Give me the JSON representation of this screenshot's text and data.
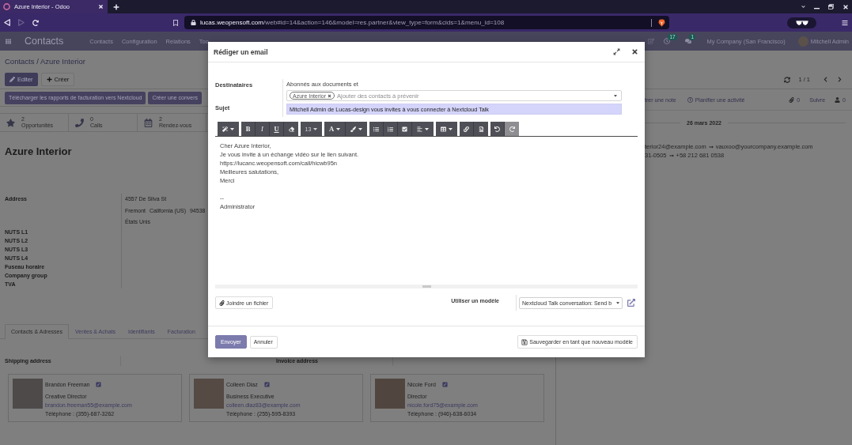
{
  "browser": {
    "tab_title": "Azure Interior - Odoo",
    "nav": [
      {
        "kind": "back",
        "disabled": false
      },
      {
        "kind": "forward",
        "disabled": true
      },
      {
        "kind": "reload",
        "disabled": false
      }
    ],
    "url_host": "lucas.weopensoft.com",
    "url_path": "/web#id=14&action=146&model=res.partner&view_type=form&cids=1&menu_id=108"
  },
  "navbar": {
    "app": "Contacts",
    "menu": [
      "Contacts",
      "Configuration",
      "Relations",
      "Too"
    ],
    "activity_count": "17",
    "message_count": "1",
    "company": "My Company (San Francisco)",
    "user": "Mitchell Admin"
  },
  "control_panel": {
    "breadcrumb": "Contacts / Azure Interior",
    "edit": "Editer",
    "create": "Créer",
    "pager": "1 / 1"
  },
  "form": {
    "action_buttons": [
      "Télécharger les rapports de facturation vers Nextcloud",
      "Créer une convers"
    ],
    "stat_buttons": [
      {
        "kind": "star",
        "value": "2",
        "label": "Opportunités"
      },
      {
        "kind": "phone",
        "value": "0",
        "label": "Calls"
      },
      {
        "kind": "calendar",
        "value": "2",
        "label": "Rendez-vous"
      }
    ],
    "name": "Azure Interior",
    "address_label": "Address",
    "address": {
      "street": "4557 De Silva St",
      "city_line": [
        "Fremont",
        "California (US)",
        "94538"
      ],
      "country": "États Unis"
    },
    "field_labels": [
      "NUTS L1",
      "NUTS L2",
      "NUTS L3",
      "NUTS L4",
      "Fuseau horaire",
      "Company group",
      "TVA"
    ],
    "tabs": [
      {
        "label": "Contacts & Adresses",
        "selected": true
      },
      {
        "label": "Ventes & Achats",
        "selected": false
      },
      {
        "label": "Identifiants",
        "selected": false
      },
      {
        "label": "Facturation",
        "selected": false
      }
    ],
    "address_headers": [
      "Shipping address",
      "Invoice address"
    ],
    "contacts": [
      {
        "name": "Brandon Freeman",
        "function": "Creative Director",
        "email": "brandon.freeman55@example.com",
        "phone": "Téléphone : (355)-687-3262"
      },
      {
        "name": "Colleen Diaz",
        "function": "Business Executive",
        "email": "colleen.diaz83@example.com",
        "phone": "Téléphone : (255)-595-8393"
      },
      {
        "name": "Nicole Ford",
        "function": "Director",
        "email": "nicole.ford75@example.com",
        "phone": "Téléphone : (946)-638-6034"
      }
    ]
  },
  "chatter": {
    "log_note": "trer une note",
    "schedule": "Planifier une activité",
    "attachment_count": "0",
    "follow": "Suivre",
    "follower_count": "0",
    "date": "26 mars 2022",
    "tracking": [
      {
        "old": "terior24@example.com",
        "new": "vauxoo@yourcompany.example.com"
      },
      {
        "old": "31-0505",
        "new": "+58 212 681 0538"
      }
    ]
  },
  "dialog": {
    "title": "Rédiger un email",
    "recipients": {
      "label": "Destinataires",
      "note": "Abonnés aux documents et",
      "tags": [
        {
          "label": "Azure Interior"
        }
      ],
      "placeholder": "Ajouter des contacts à prévenir",
      "required": false
    },
    "subject": {
      "label": "Sujet",
      "value": "Mitchell Admin de Lucas-design vous invites à vous connecter à Nextcloud Talk",
      "required": true
    },
    "toolbar": [
      {
        "buttons": [
          {
            "kind": "style",
            "disabled": false
          }
        ]
      },
      {
        "buttons": [
          {
            "kind": "bold",
            "label": "B",
            "disabled": false
          },
          {
            "kind": "italic",
            "label": "I",
            "disabled": false
          },
          {
            "kind": "underline",
            "label": "U",
            "disabled": false
          },
          {
            "kind": "eraser",
            "disabled": false
          }
        ]
      },
      {
        "buttons": [
          {
            "kind": "size",
            "label": "13",
            "disabled": false
          }
        ]
      },
      {
        "buttons": [
          {
            "kind": "color",
            "label": "A",
            "disabled": false
          },
          {
            "kind": "brush",
            "disabled": false
          }
        ]
      },
      {
        "buttons": [
          {
            "kind": "bullets",
            "disabled": false
          },
          {
            "kind": "numbers",
            "disabled": false
          },
          {
            "kind": "checklist",
            "disabled": false
          },
          {
            "kind": "align",
            "disabled": false
          }
        ]
      },
      {
        "buttons": [
          {
            "kind": "table",
            "disabled": false
          }
        ]
      },
      {
        "buttons": [
          {
            "kind": "link",
            "disabled": false
          },
          {
            "kind": "image",
            "disabled": false
          }
        ]
      },
      {
        "buttons": [
          {
            "kind": "undo",
            "disabled": false
          },
          {
            "kind": "redo",
            "disabled": true
          }
        ]
      }
    ],
    "body": {
      "lines": [
        "Cher Azure Interior,",
        "Je vous invite à un échange vidéo sur le lien suivant.",
        "https://lucanc.weopensoft.com/call/hicwb95n",
        "Meilleures salutations,",
        "Merci"
      ],
      "signature": [
        "--",
        "Administrator"
      ]
    },
    "attach": "Joindre un fichier",
    "template": {
      "label": "Utiliser un modèle",
      "value": "Nextcloud Talk conversation: Send b"
    },
    "footer": {
      "send": "Envoyer",
      "cancel": "Annuler",
      "save_template": "Sauvegarder en tant que nouveau modèle"
    }
  }
}
